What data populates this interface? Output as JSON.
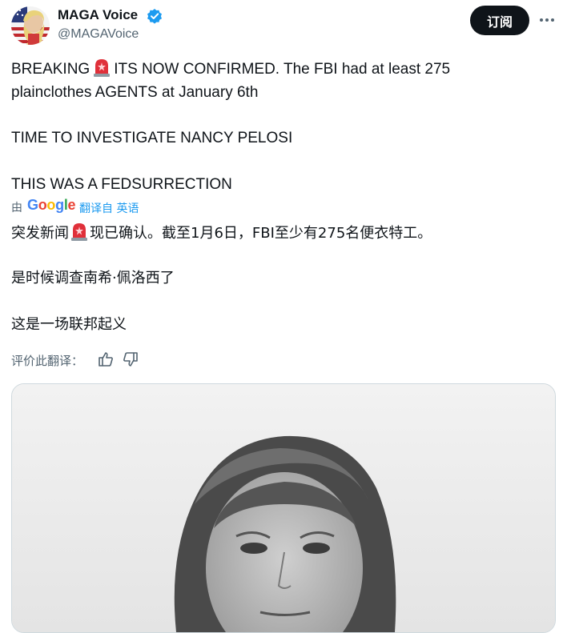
{
  "author": {
    "display_name": "MAGA Voice",
    "handle": "@MAGAVoice",
    "verified_icon": "verified-badge-icon",
    "avatar_icon": "avatar-image"
  },
  "actions": {
    "subscribe_label": "订阅",
    "more_icon": "more-options-icon"
  },
  "tweet": {
    "line1_prefix": "BREAKING",
    "line1_suffix": "ITS NOW CONFIRMED. The FBI had at least 275",
    "line2": "plainclothes AGENTS at January 6th",
    "line3": "TIME TO INVESTIGATE NANCY PELOSI",
    "line4": "THIS WAS A FEDSURRECTION",
    "emoji_icon": "police-light-icon"
  },
  "translation": {
    "by_label": "由",
    "provider": "Google",
    "translated_from": "翻译自 英语",
    "line1_prefix": "突发新闻",
    "line1_suffix": "现已确认。截至1月6日，FBI至少有275名便衣特工。",
    "line2": "是时候调查南希·佩洛西了",
    "line3": "这是一场联邦起义",
    "rate_label": "评价此翻译：",
    "thumb_up_icon": "thumbs-up-icon",
    "thumb_down_icon": "thumbs-down-icon"
  },
  "media": {
    "image_icon": "portrait-photo"
  },
  "colors": {
    "text": "#0f1419",
    "secondary": "#536471",
    "accent": "#1d9bf0",
    "button_bg": "#0f1419"
  }
}
